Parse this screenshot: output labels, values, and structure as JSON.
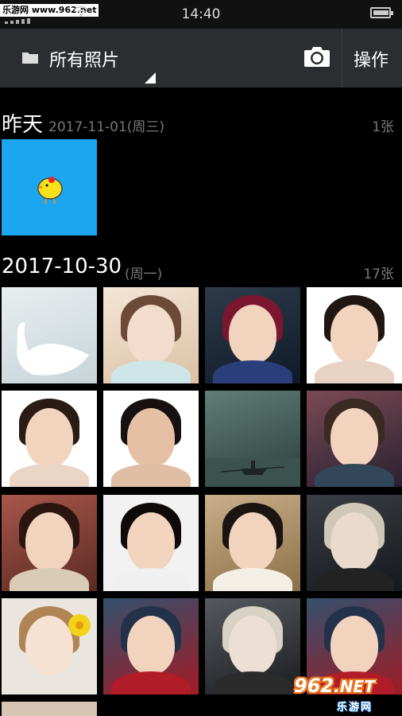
{
  "status_bar": {
    "watermark_site": "乐游网 www.962.net",
    "time": "14:40",
    "battery_level": 0.85
  },
  "top_bar": {
    "album_title": "所有照片",
    "actions_label": "操作"
  },
  "sections": [
    {
      "date": "昨天",
      "date_detail": "2017-11-01(周三)",
      "count": "1张"
    },
    {
      "date": "2017-10-30",
      "date_detail": "(周一)",
      "count": "17张"
    }
  ],
  "bottom_watermark": {
    "brand_number": "962",
    "brand_suffix": ".NET",
    "brand_cn": "乐游网"
  },
  "colors": {
    "background": "#000000",
    "top_bar": "#2b2d30",
    "muted_text": "#777777",
    "watermark_orange": "#e8731c",
    "watermark_blue": "#1a6fc0",
    "thumb_sky": "#1da6f0"
  }
}
